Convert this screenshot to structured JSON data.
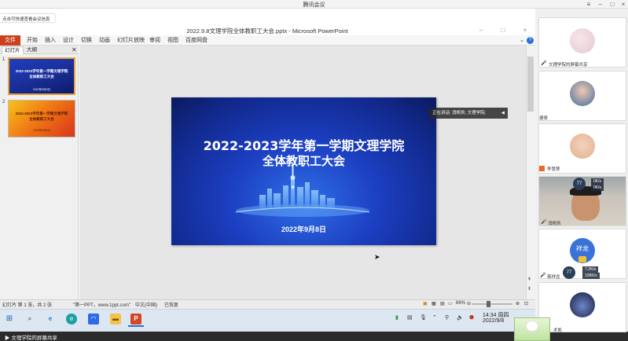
{
  "meeting": {
    "title": "腾讯会议",
    "hint": "点击可快速查看会议信息",
    "share_footer": "文理学院的屏幕共享",
    "speaking": "正在讲话: 消帆凯; 文理学院;"
  },
  "ppt": {
    "window_title": "2022.9.8文理学院全体教职工大会.pptx - Microsoft PowerPoint",
    "file_tab": "文件",
    "tabs": [
      "开始",
      "插入",
      "设计",
      "切换",
      "动画",
      "幻灯片放映",
      "审阅",
      "视图",
      "百度网盘"
    ],
    "pane_tabs": [
      "幻灯片",
      "大纲"
    ],
    "slide_numbers": [
      "1",
      "2"
    ],
    "thumbnails": [
      {
        "line1": "2022-2023学年第一学期文理学院",
        "line2": "全体教职工大会",
        "date": "2022年9月8日"
      },
      {
        "line1": "2022-2023学年第一学期文理学院",
        "line2": "全体教职工大会",
        "date": "2022年9月8日"
      }
    ],
    "slide": {
      "title_line1": "2022-2023学年第一学期文理学院",
      "title_line2": "全体教职工大会",
      "date": "2022年9月8日"
    },
    "status": {
      "slide_info": "幻灯片 第 1 张，共 2 张",
      "theme": "\"第一PPT，www.1ppt.com\"",
      "language": "中文(中国)",
      "recovered": "已恢复",
      "zoom": "66%"
    }
  },
  "taskbar": {
    "time": "14:34 周四",
    "date": "2022/9/8"
  },
  "participants": [
    {
      "name": "文理学院的屏幕共享"
    },
    {
      "name": "德哥"
    },
    {
      "name": "李慧莲"
    },
    {
      "name": "消帆凯",
      "net_score": "77",
      "net_up": "0K/s",
      "net_down": "0K/s"
    },
    {
      "name": "蒋祥龙",
      "avatar_text": "祥龙",
      "net_score": "77",
      "net_up": "7.2K/s",
      "net_down": "108K/s"
    },
    {
      "name": "术凯"
    }
  ],
  "colors": {
    "accent_file_tab": "#c9411d",
    "slide_blue": "#1c3fc2",
    "thumb_selected_border": "#e8a33a"
  }
}
